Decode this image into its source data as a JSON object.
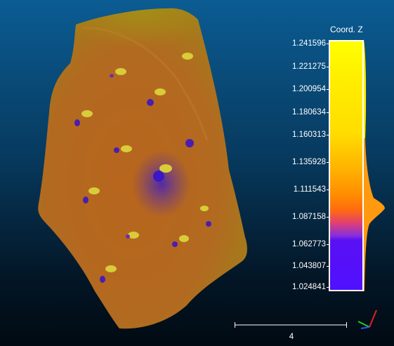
{
  "scalar_field": {
    "title": "Coord. Z",
    "ticks": [
      "1.241596",
      "1.221275",
      "1.200954",
      "1.180634",
      "1.160313",
      "1.135928",
      "1.111543",
      "1.087158",
      "1.062773",
      "1.043807",
      "1.024841"
    ],
    "colormap": [
      "#5010ff",
      "#8a30d8",
      "#ff6a10",
      "#ff8c00",
      "#ffdd00",
      "#ffff00"
    ]
  },
  "scale": {
    "label": "4"
  },
  "axes": {
    "x_color": "#e02020",
    "y_color": "#20d020",
    "z_color": "#3050ff"
  }
}
